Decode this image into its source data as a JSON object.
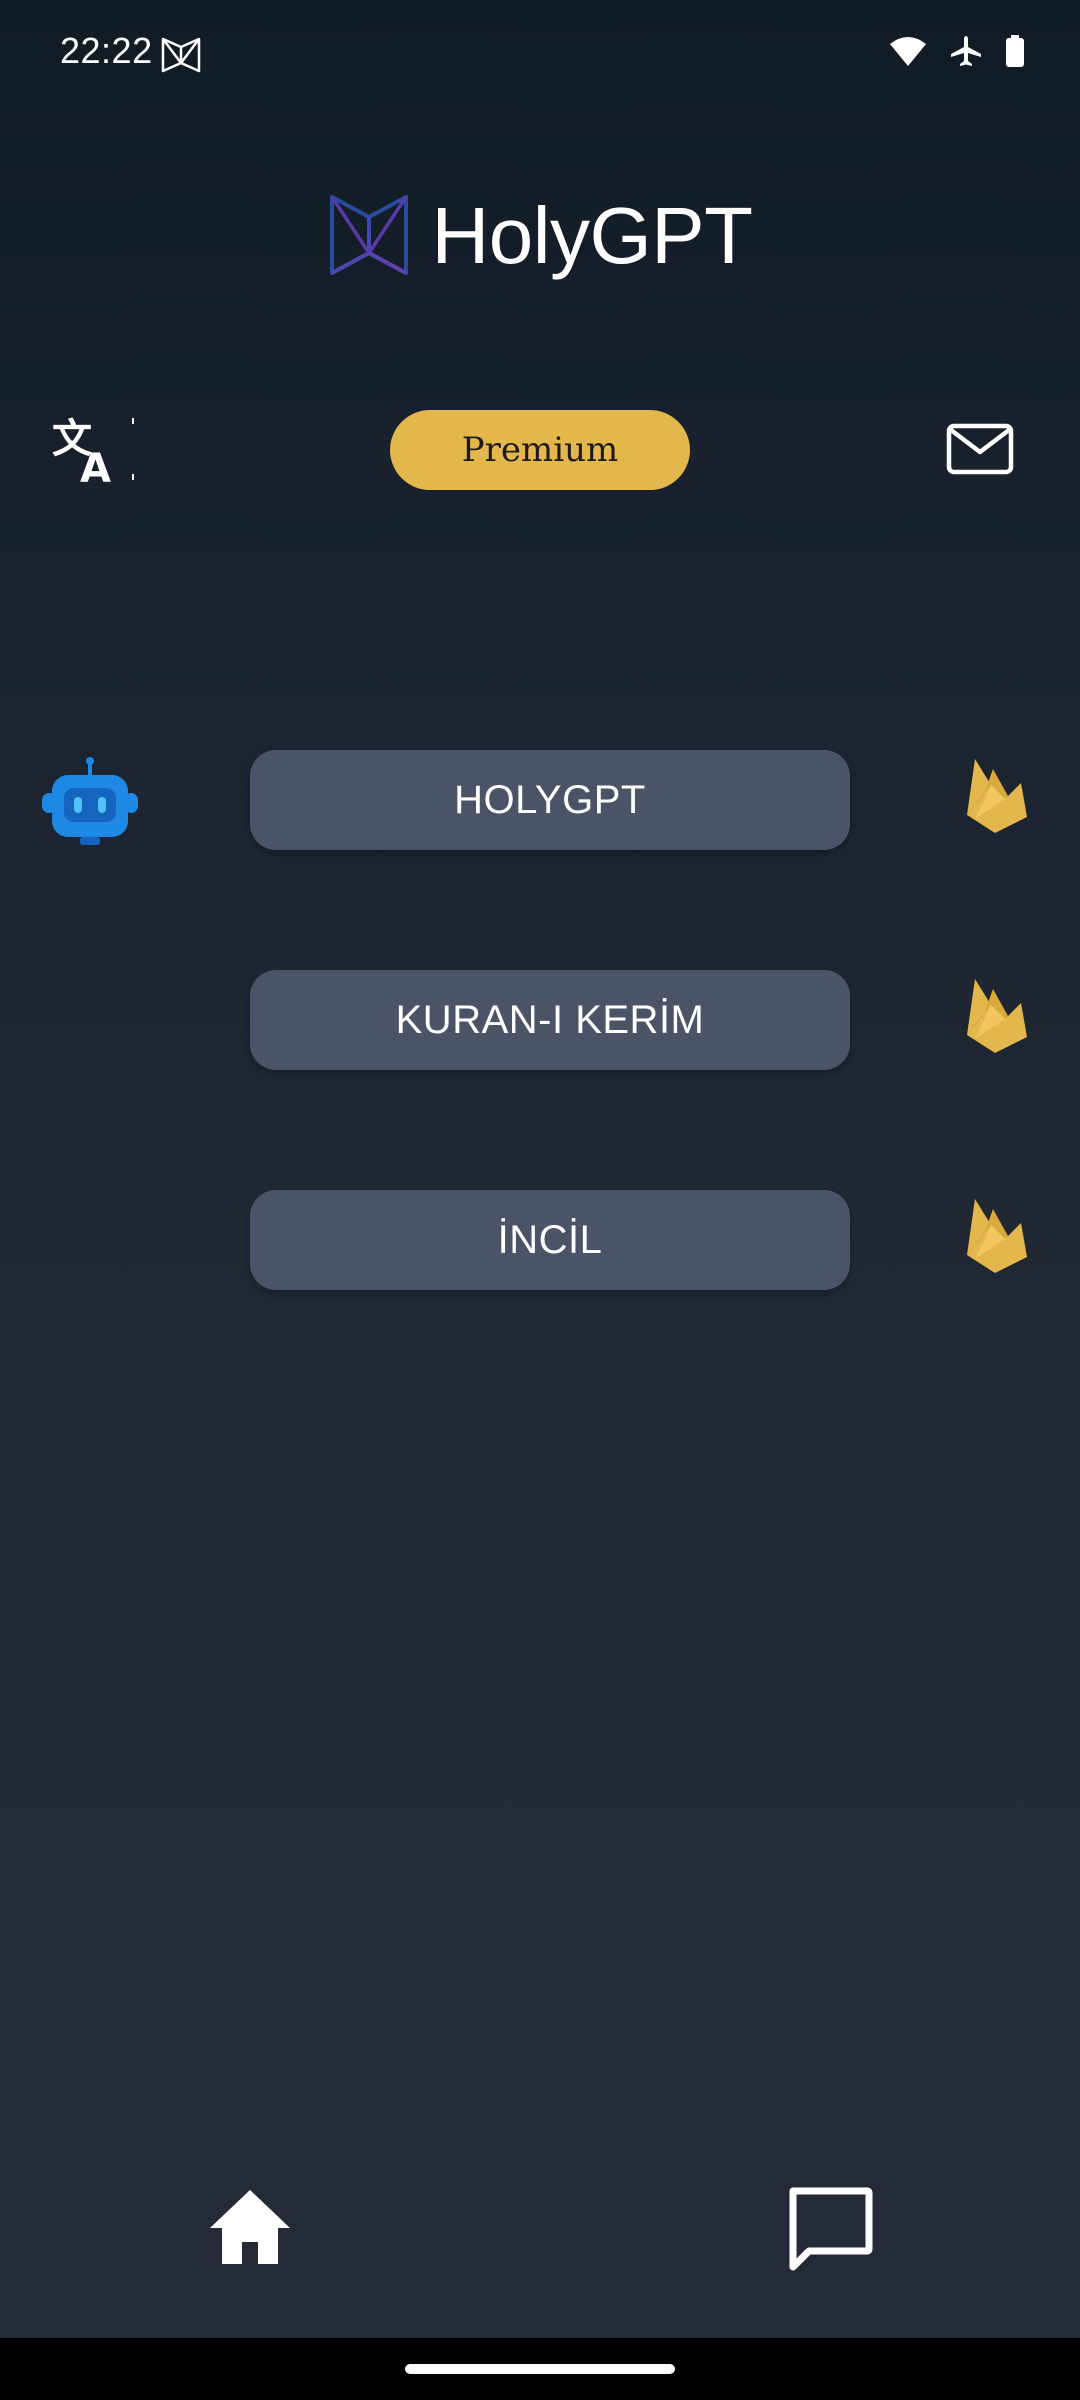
{
  "status_bar": {
    "time": "22:22",
    "icons": [
      "app-logo-icon",
      "wifi-icon",
      "airplane-icon",
      "battery-icon"
    ]
  },
  "header": {
    "app_name": "HolyGPT",
    "logo_icon": "book-logo-icon"
  },
  "toolbar": {
    "translate_icon": "translate-icon",
    "premium_label": "Premium",
    "mail_icon": "mail-icon"
  },
  "menu": {
    "items": [
      {
        "label": "HOLYGPT",
        "icon": "flame-icon",
        "leading_icon": "robot-icon"
      },
      {
        "label": "KURAN-I KERİM",
        "icon": "flame-icon"
      },
      {
        "label": "İNCİL",
        "icon": "flame-icon"
      }
    ]
  },
  "bottom_nav": {
    "items": [
      {
        "name": "home",
        "icon": "home-icon"
      },
      {
        "name": "chat",
        "icon": "chat-icon"
      }
    ]
  },
  "colors": {
    "accent": "#e4b74d",
    "button_bg": "#4b5467",
    "background": "#232a35",
    "robot_blue": "#1e88e5"
  }
}
